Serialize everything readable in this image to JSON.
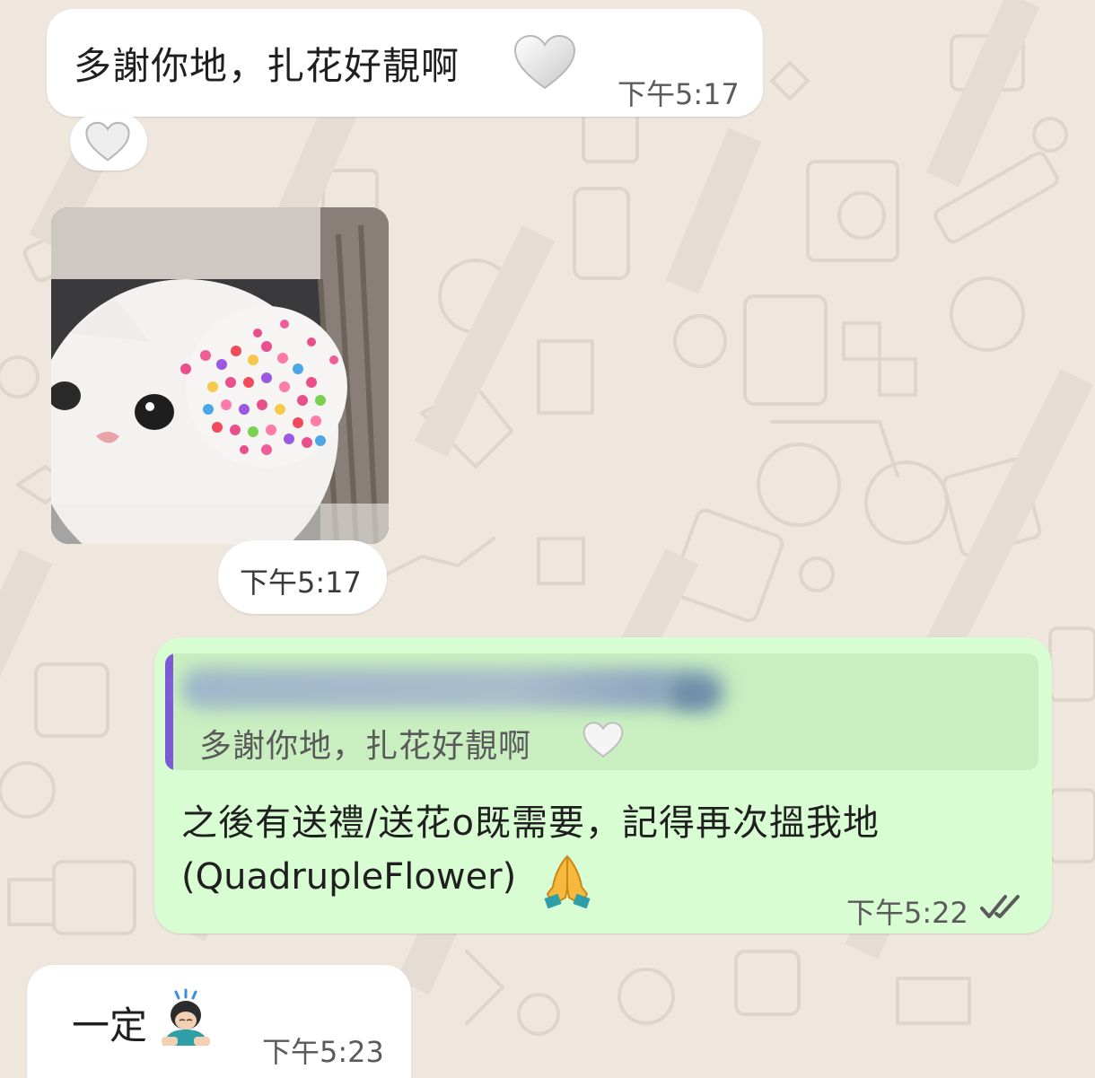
{
  "messages": [
    {
      "text": "多謝你地，扎花好靚啊",
      "time": "下午5:17"
    },
    {
      "photo_time": "下午5:17"
    },
    {
      "quote_text": "多謝你地，扎花好靚啊",
      "text_line1": "之後有送禮/送花o既需要，記得再次搵我地",
      "text_line2": "(QuadrupleFlower)",
      "time": "下午5:22",
      "status": "read"
    },
    {
      "text": "一定",
      "time": "下午5:23"
    }
  ],
  "icons": {
    "heart": "white-heart-icon",
    "pray": "folded-hands-icon",
    "bow": "person-bowing-icon",
    "ticks": "double-check-icon"
  },
  "colors": {
    "wallpaper": "#efe7de",
    "incoming_bubble": "#ffffff",
    "outgoing_bubble": "#d9fdd3",
    "quote_bar": "#7c5ad7",
    "read_ticks": "#5b5b5b"
  }
}
